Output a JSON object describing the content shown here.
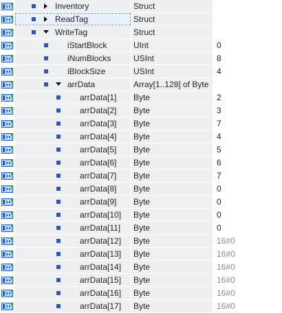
{
  "rows": [
    {
      "level": 0,
      "expander": "collapsed",
      "name": "Inventory",
      "type": "Struct",
      "value": "",
      "selected": false
    },
    {
      "level": 0,
      "expander": "collapsed",
      "name": "ReadTag",
      "type": "Struct",
      "value": "",
      "selected": true
    },
    {
      "level": 0,
      "expander": "expanded",
      "name": "WriteTag",
      "type": "Struct",
      "value": "",
      "selected": false
    },
    {
      "level": 1,
      "expander": "none",
      "name": "iStartBlock",
      "type": "UInt",
      "value": "0"
    },
    {
      "level": 1,
      "expander": "none",
      "name": "iNumBlocks",
      "type": "USInt",
      "value": "8"
    },
    {
      "level": 1,
      "expander": "none",
      "name": "iBlockSize",
      "type": "USInt",
      "value": "4"
    },
    {
      "level": 1,
      "expander": "expanded",
      "name": "arrData",
      "type": "Array[1..128] of Byte",
      "value": ""
    },
    {
      "level": 2,
      "expander": "none",
      "name": "arrData[1]",
      "type": "Byte",
      "value": "2"
    },
    {
      "level": 2,
      "expander": "none",
      "name": "arrData[2]",
      "type": "Byte",
      "value": "3"
    },
    {
      "level": 2,
      "expander": "none",
      "name": "arrData[3]",
      "type": "Byte",
      "value": "7"
    },
    {
      "level": 2,
      "expander": "none",
      "name": "arrData[4]",
      "type": "Byte",
      "value": "4"
    },
    {
      "level": 2,
      "expander": "none",
      "name": "arrData[5]",
      "type": "Byte",
      "value": "5"
    },
    {
      "level": 2,
      "expander": "none",
      "name": "arrData[6]",
      "type": "Byte",
      "value": "6"
    },
    {
      "level": 2,
      "expander": "none",
      "name": "arrData[7]",
      "type": "Byte",
      "value": "7"
    },
    {
      "level": 2,
      "expander": "none",
      "name": "arrData[8]",
      "type": "Byte",
      "value": "0"
    },
    {
      "level": 2,
      "expander": "none",
      "name": "arrData[9]",
      "type": "Byte",
      "value": "0"
    },
    {
      "level": 2,
      "expander": "none",
      "name": "arrData[10]",
      "type": "Byte",
      "value": "0"
    },
    {
      "level": 2,
      "expander": "none",
      "name": "arrData[11]",
      "type": "Byte",
      "value": "0"
    },
    {
      "level": 2,
      "expander": "none",
      "name": "arrData[12]",
      "type": "Byte",
      "value": "16#0",
      "dim": true
    },
    {
      "level": 2,
      "expander": "none",
      "name": "arrData[13]",
      "type": "Byte",
      "value": "16#0",
      "dim": true
    },
    {
      "level": 2,
      "expander": "none",
      "name": "arrData[14]",
      "type": "Byte",
      "value": "16#0",
      "dim": true
    },
    {
      "level": 2,
      "expander": "none",
      "name": "arrData[15]",
      "type": "Byte",
      "value": "16#0",
      "dim": true
    },
    {
      "level": 2,
      "expander": "none",
      "name": "arrData[16]",
      "type": "Byte",
      "value": "16#0",
      "dim": true
    },
    {
      "level": 2,
      "expander": "none",
      "name": "arrData[17]",
      "type": "Byte",
      "value": "16#0",
      "dim": true
    }
  ],
  "colors": {
    "icon_blue": "#1f5fbf",
    "icon_green": "#3aa845",
    "bullet": "#2e55b8",
    "cell_bg": "#eeeff1",
    "dim_value": "#8a8a8a"
  },
  "icons": {
    "row_icon": "db-element-icon",
    "collapsed": "triangle-right-icon",
    "expanded": "triangle-down-icon",
    "bullet": "bullet-icon"
  }
}
